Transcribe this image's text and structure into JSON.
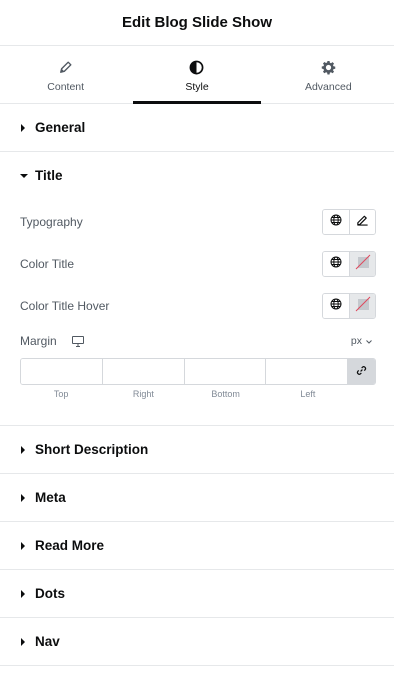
{
  "header": {
    "title": "Edit Blog Slide Show"
  },
  "tabs": [
    {
      "label": "Content",
      "icon": "pencil-icon"
    },
    {
      "label": "Style",
      "icon": "contrast-icon",
      "active": true
    },
    {
      "label": "Advanced",
      "icon": "gear-icon"
    }
  ],
  "sections": {
    "general": "General",
    "title": "Title",
    "short_description": "Short Description",
    "meta": "Meta",
    "read_more": "Read More",
    "dots": "Dots",
    "nav": "Nav"
  },
  "title_controls": {
    "typography": "Typography",
    "color_title": "Color Title",
    "color_title_hover": "Color Title Hover",
    "margin": "Margin",
    "unit": "px",
    "margin_values": {
      "top": "",
      "right": "",
      "bottom": "",
      "left": ""
    },
    "dim_labels": {
      "top": "Top",
      "right": "Right",
      "bottom": "Bottom",
      "left": "Left"
    }
  },
  "colors": {
    "accent": "#0c0d0e",
    "border": "#d5d8dc",
    "muted": "#515962",
    "swatch_empty_slash": "#e0455b"
  }
}
